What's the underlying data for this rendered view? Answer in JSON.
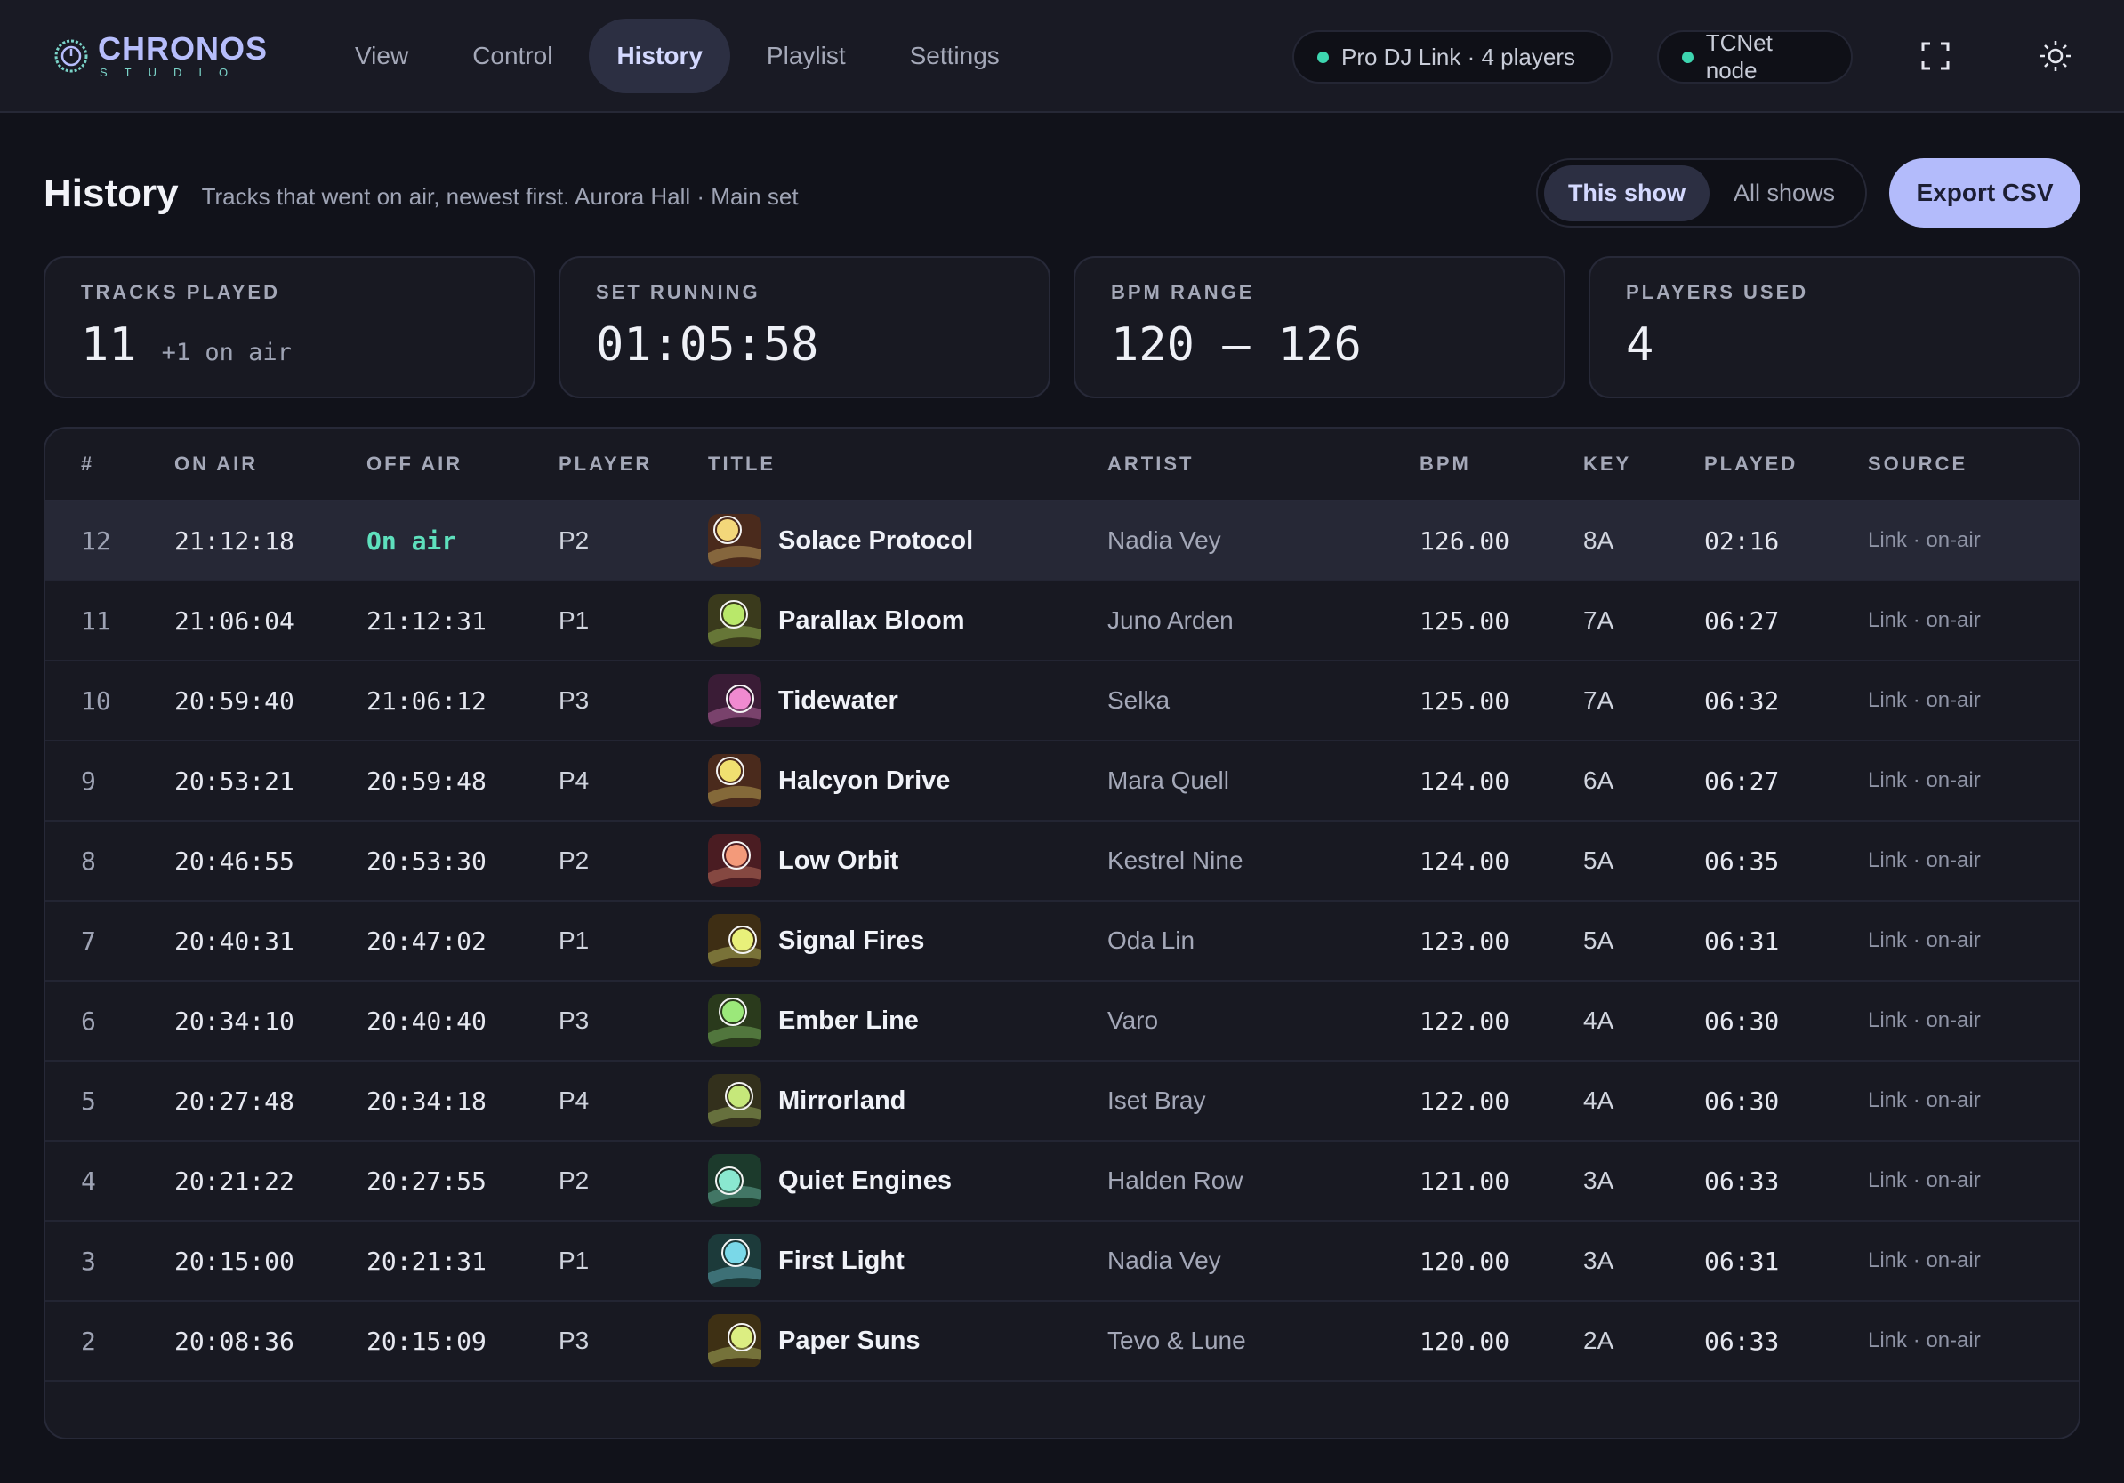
{
  "app": {
    "brand_name": "CHRONOS",
    "brand_sub": "STUDIO",
    "nav": [
      "View",
      "Control",
      "History",
      "Playlist",
      "Settings"
    ],
    "active_nav": "History",
    "status_link_left": "Pro DJ Link ·",
    "status_link_right": "4  players",
    "status_tcnet": "TCNet node",
    "status_color": "#3dd6b0"
  },
  "header": {
    "title": "History",
    "subtitle": "Tracks that went on air, newest first. Aurora Hall · Main set",
    "seg_this": "This show",
    "seg_all": "All shows",
    "export": "Export CSV"
  },
  "stats": {
    "tracks_label": "TRACKS PLAYED",
    "tracks_value": "11",
    "tracks_extra": "+1 on air",
    "running_label": "SET RUNNING",
    "running_value": "01:05:58",
    "bpm_label": "BPM RANGE",
    "bpm_value": "120 – 126",
    "players_label": "PLAYERS USED",
    "players_value": "4"
  },
  "table": {
    "headers": [
      "#",
      "ON AIR",
      "OFF AIR",
      "PLAYER",
      "TITLE",
      "ARTIST",
      "BPM",
      "KEY",
      "PLAYED",
      "SOURCE"
    ],
    "rows": [
      {
        "num": "12",
        "on": "21:12:18",
        "off": "On air",
        "player": "P2",
        "title": "Solace Protocol",
        "artist": "Nadia Vey",
        "bpm": "126.00",
        "key": "8A",
        "played": "02:16",
        "source": "Link · on-air",
        "art_bg": "#4a2a1c",
        "art_dot": "#f3d77a"
      },
      {
        "num": "11",
        "on": "21:06:04",
        "off": "21:12:31",
        "player": "P1",
        "title": "Parallax Bloom",
        "artist": "Juno Arden",
        "bpm": "125.00",
        "key": "7A",
        "played": "06:27",
        "source": "Link · on-air",
        "art_bg": "#3a3a1c",
        "art_dot": "#b9e86a"
      },
      {
        "num": "10",
        "on": "20:59:40",
        "off": "21:06:12",
        "player": "P3",
        "title": "Tidewater",
        "artist": "Selka",
        "bpm": "125.00",
        "key": "7A",
        "played": "06:32",
        "source": "Link · on-air",
        "art_bg": "#3a1c36",
        "art_dot": "#f08ad0"
      },
      {
        "num": "9",
        "on": "20:53:21",
        "off": "20:59:48",
        "player": "P4",
        "title": "Halcyon Drive",
        "artist": "Mara Quell",
        "bpm": "124.00",
        "key": "6A",
        "played": "06:27",
        "source": "Link · on-air",
        "art_bg": "#4a2a1c",
        "art_dot": "#f0e070"
      },
      {
        "num": "8",
        "on": "20:46:55",
        "off": "20:53:30",
        "player": "P2",
        "title": "Low Orbit",
        "artist": "Kestrel Nine",
        "bpm": "124.00",
        "key": "5A",
        "played": "06:35",
        "source": "Link · on-air",
        "art_bg": "#4a1c22",
        "art_dot": "#f39a7a"
      },
      {
        "num": "7",
        "on": "20:40:31",
        "off": "20:47:02",
        "player": "P1",
        "title": "Signal Fires",
        "artist": "Oda Lin",
        "bpm": "123.00",
        "key": "5A",
        "played": "06:31",
        "source": "Link · on-air",
        "art_bg": "#3e2e14",
        "art_dot": "#e8f07a"
      },
      {
        "num": "6",
        "on": "20:34:10",
        "off": "20:40:40",
        "player": "P3",
        "title": "Ember Line",
        "artist": "Varo",
        "bpm": "122.00",
        "key": "4A",
        "played": "06:30",
        "source": "Link · on-air",
        "art_bg": "#2a3a1c",
        "art_dot": "#9be87a"
      },
      {
        "num": "5",
        "on": "20:27:48",
        "off": "20:34:18",
        "player": "P4",
        "title": "Mirrorland",
        "artist": "Iset Bray",
        "bpm": "122.00",
        "key": "4A",
        "played": "06:30",
        "source": "Link · on-air",
        "art_bg": "#33301c",
        "art_dot": "#c6e87a"
      },
      {
        "num": "4",
        "on": "20:21:22",
        "off": "20:27:55",
        "player": "P2",
        "title": "Quiet Engines",
        "artist": "Halden Row",
        "bpm": "121.00",
        "key": "3A",
        "played": "06:33",
        "source": "Link · on-air",
        "art_bg": "#1c3a2c",
        "art_dot": "#8ae8d0"
      },
      {
        "num": "3",
        "on": "20:15:00",
        "off": "20:21:31",
        "player": "P1",
        "title": "First Light",
        "artist": "Nadia Vey",
        "bpm": "120.00",
        "key": "3A",
        "played": "06:31",
        "source": "Link · on-air",
        "art_bg": "#1c3a3a",
        "art_dot": "#7ad8e8"
      },
      {
        "num": "2",
        "on": "20:08:36",
        "off": "20:15:09",
        "player": "P3",
        "title": "Paper Suns",
        "artist": "Tevo & Lune",
        "bpm": "120.00",
        "key": "2A",
        "played": "06:33",
        "source": "Link · on-air",
        "art_bg": "#3e3014",
        "art_dot": "#dcee82"
      }
    ]
  }
}
